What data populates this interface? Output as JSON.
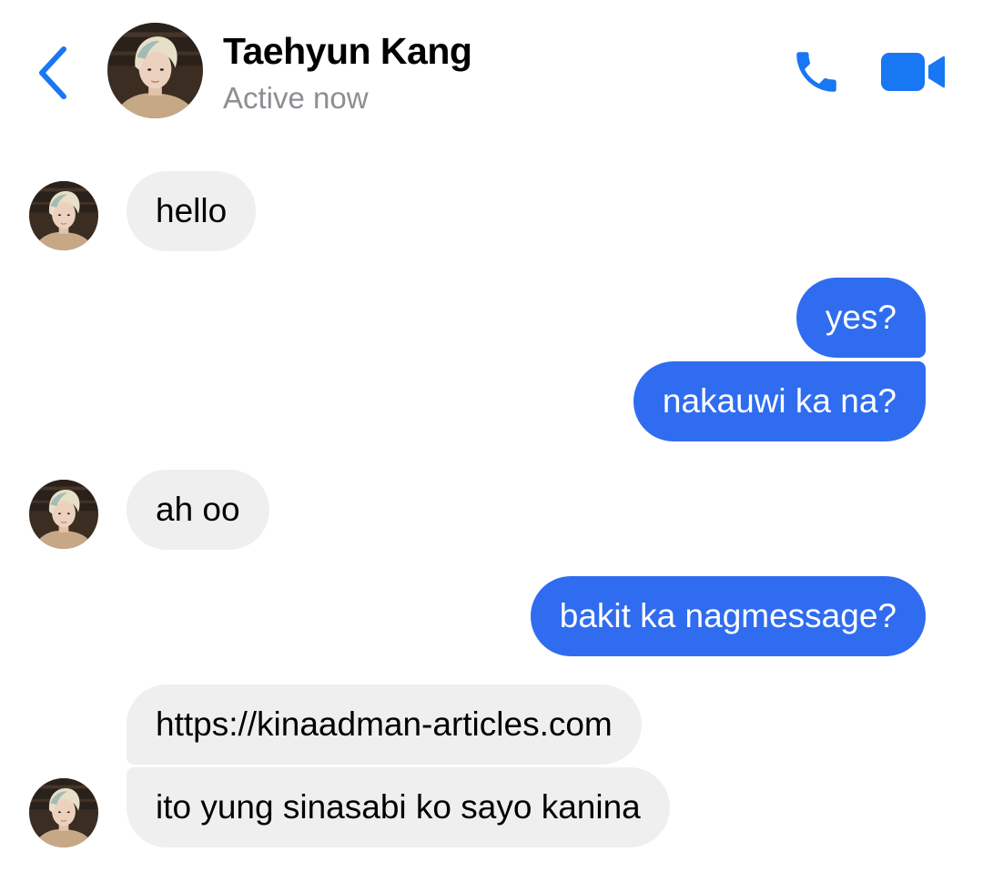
{
  "header": {
    "contact_name": "Taehyun Kang",
    "status": "Active now",
    "icons": {
      "back": "chevron-left-icon",
      "call": "phone-icon",
      "video": "video-camera-icon"
    }
  },
  "colors": {
    "accent": "#1877F2",
    "outgoing_bubble": "#2F6CF0",
    "incoming_bubble": "#EFEFEF",
    "status_text": "#8E8E93"
  },
  "messages": [
    {
      "direction": "incoming",
      "text": "hello"
    },
    {
      "direction": "outgoing",
      "text": "yes?"
    },
    {
      "direction": "outgoing",
      "text": "nakauwi ka na?"
    },
    {
      "direction": "incoming",
      "text": "ah oo"
    },
    {
      "direction": "outgoing",
      "text": "bakit ka nagmessage?"
    },
    {
      "direction": "incoming",
      "text": "https://kinaadman-articles.com"
    },
    {
      "direction": "incoming",
      "text": "ito yung sinasabi ko sayo kanina"
    }
  ]
}
